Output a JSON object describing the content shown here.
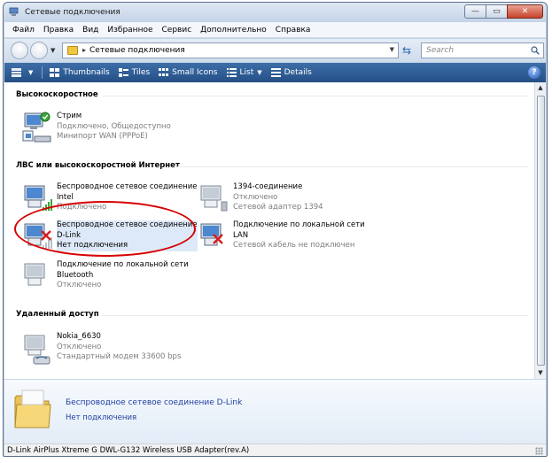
{
  "window": {
    "title": "Сетевые подключения"
  },
  "window_controls": {
    "minimize": "—",
    "maximize": "▭",
    "close": "✕"
  },
  "menu": [
    "Файл",
    "Правка",
    "Вид",
    "Избранное",
    "Сервис",
    "Дополнительно",
    "Справка"
  ],
  "address": {
    "path": "Сетевые подключения"
  },
  "search": {
    "placeholder": "Search"
  },
  "toolbar": {
    "thumbnails": "Thumbnails",
    "tiles": "Tiles",
    "small_icons": "Small Icons",
    "list": "List",
    "details": "Details",
    "help": "?"
  },
  "groups": [
    {
      "title": "Высокоскоростное",
      "items": [
        {
          "name": "Стрим",
          "status": "Подключено, Общедоступно",
          "device": "Минипорт WAN (PPPoE)"
        }
      ]
    },
    {
      "title": "ЛВС или высокоскоростной Интернет",
      "items": [
        {
          "name": "Беспроводное сетевое соединение",
          "device": "Intel",
          "status": "Подключено"
        },
        {
          "name": "1394-соединение",
          "status": "Отключено",
          "device": "Сетевой адаптер 1394"
        },
        {
          "name": "Беспроводное сетевое соединение",
          "device": "D-Link",
          "status": "Нет подключения"
        },
        {
          "name": "Подключение по локальной сети",
          "device": "LAN",
          "status": "Сетевой кабель не подключен"
        },
        {
          "name": "Подключение по локальной сети",
          "device": "Bluetooth",
          "status": "Отключено"
        }
      ]
    },
    {
      "title": "Удаленный доступ",
      "items": [
        {
          "name": "Nokia_6630",
          "status": "Отключено",
          "device": "Стандартный модем 33600 bps"
        }
      ]
    }
  ],
  "details_pane": {
    "title": "Беспроводное сетевое соединение D-Link",
    "status": "Нет подключения"
  },
  "statusbar": {
    "text": "D-Link AirPlus Xtreme G DWL-G132 Wireless USB Adapter(rev.A)"
  }
}
